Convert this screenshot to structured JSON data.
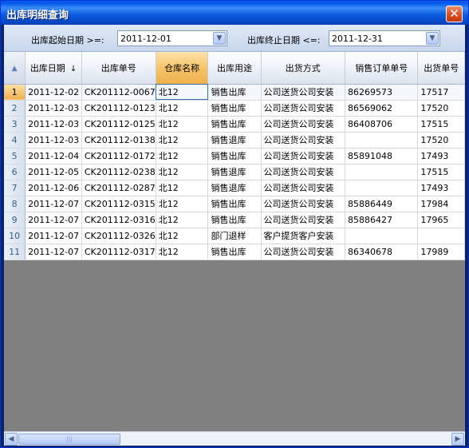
{
  "window": {
    "title": "出库明细查询",
    "close_glyph": "✕"
  },
  "filter": {
    "start_label": "出库起始日期 >=:",
    "start_value": "2011-12-01",
    "end_label": "出库终止日期 <=:",
    "end_value": "2011-12-31"
  },
  "grid": {
    "columns": [
      "出库日期",
      "出库单号",
      "仓库名称",
      "出库用途",
      "出货方式",
      "销售订单单号",
      "出货单号"
    ],
    "sort_glyph": "↓",
    "rows": [
      {
        "n": "1",
        "date": "2011-12-02",
        "no": "CK201112-0067",
        "wh": "北12",
        "use": "销售出库",
        "ship": "公司送货公司安装",
        "order": "86269573",
        "out": "17517"
      },
      {
        "n": "2",
        "date": "2011-12-03",
        "no": "CK201112-0123",
        "wh": "北12",
        "use": "销售出库",
        "ship": "公司送货公司安装",
        "order": "86569062",
        "out": "17520"
      },
      {
        "n": "3",
        "date": "2011-12-03",
        "no": "CK201112-0125",
        "wh": "北12",
        "use": "销售出库",
        "ship": "公司送货公司安装",
        "order": "86408706",
        "out": "17515"
      },
      {
        "n": "4",
        "date": "2011-12-03",
        "no": "CK201112-0138",
        "wh": "北12",
        "use": "销售退库",
        "ship": "公司送货公司安装",
        "order": "",
        "out": "17520"
      },
      {
        "n": "5",
        "date": "2011-12-04",
        "no": "CK201112-0172",
        "wh": "北12",
        "use": "销售出库",
        "ship": "公司送货公司安装",
        "order": "85891048",
        "out": "17493"
      },
      {
        "n": "6",
        "date": "2011-12-05",
        "no": "CK201112-0238",
        "wh": "北12",
        "use": "销售退库",
        "ship": "公司送货公司安装",
        "order": "",
        "out": "17515"
      },
      {
        "n": "7",
        "date": "2011-12-06",
        "no": "CK201112-0287",
        "wh": "北12",
        "use": "销售退库",
        "ship": "公司送货公司安装",
        "order": "",
        "out": "17493"
      },
      {
        "n": "8",
        "date": "2011-12-07",
        "no": "CK201112-0315",
        "wh": "北12",
        "use": "销售出库",
        "ship": "公司送货公司安装",
        "order": "85886449",
        "out": "17984"
      },
      {
        "n": "9",
        "date": "2011-12-07",
        "no": "CK201112-0316",
        "wh": "北12",
        "use": "销售出库",
        "ship": "公司送货公司安装",
        "order": "85886427",
        "out": "17965"
      },
      {
        "n": "10",
        "date": "2011-12-07",
        "no": "CK201112-0326",
        "wh": "北12",
        "use": "部门退样",
        "ship": "客户提货客户安装",
        "order": "",
        "out": ""
      },
      {
        "n": "11",
        "date": "2011-12-07",
        "no": "CK201112-0317",
        "wh": "北12",
        "use": "销售出库",
        "ship": "公司送货公司安装",
        "order": "86340678",
        "out": "17989"
      }
    ]
  },
  "scrollbar": {
    "left_glyph": "◀",
    "right_glyph": "▶",
    "thumb_glyph": "|||"
  },
  "colors": {
    "title_bar": "#0a5ae6",
    "sorted_header": "#f6c46c",
    "selected_row_header": "#f0b04c",
    "empty_area": "#808080"
  }
}
